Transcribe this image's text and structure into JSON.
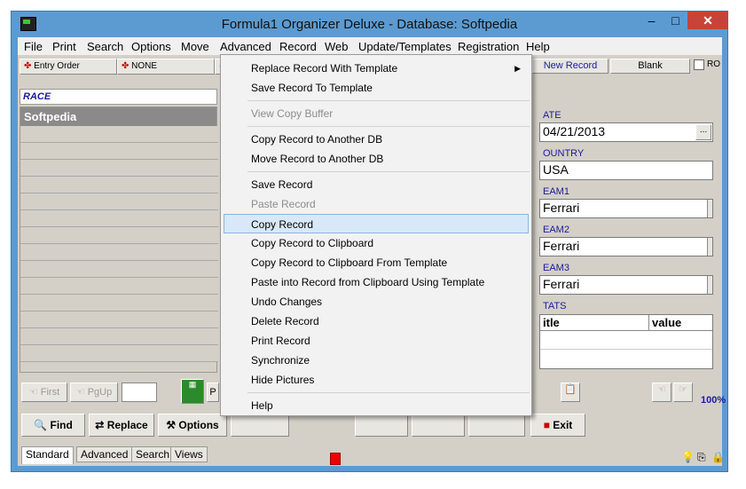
{
  "window": {
    "title": "Formula1 Organizer Deluxe - Database: Softpedia"
  },
  "menubar": [
    "File",
    "Print",
    "Search",
    "Options",
    "Move",
    "Advanced",
    "Record",
    "Web",
    "Update/Templates",
    "Registration",
    "Help"
  ],
  "toolbar": {
    "entry_order": "Entry Order",
    "none": "NONE",
    "new_record": "New Record",
    "blank": "Blank",
    "ro": "RO"
  },
  "list": {
    "header": "RACE",
    "selected": "Softpedia"
  },
  "fields": {
    "date_label": "ATE",
    "date_value": "04/21/2013",
    "date_button": "...",
    "country_label": "OUNTRY",
    "country_value": "USA",
    "team1_label": "EAM1",
    "team1_value": "Ferrari",
    "team2_label": "EAM2",
    "team2_value": "Ferrari",
    "team3_label": "EAM3",
    "team3_value": "Ferrari",
    "stats_label": "TATS",
    "stats_col1": "itle",
    "stats_col2": "value"
  },
  "nav": {
    "first": "First",
    "pgup": "PgUp",
    "p_partial": "P",
    "zoom": "100%"
  },
  "bottom_buttons": {
    "find": "Find",
    "replace": "Replace",
    "options": "Options",
    "exit": "Exit"
  },
  "tabs": [
    "Standard",
    "Advanced",
    "Search",
    "Views"
  ],
  "dropdown": {
    "items": [
      {
        "label": "Replace Record With Template",
        "disabled": false,
        "submenu": true
      },
      {
        "label": "Save Record To Template",
        "disabled": false
      },
      {
        "label": "View Copy Buffer",
        "disabled": true
      },
      {
        "label": "Copy Record to Another DB",
        "disabled": false
      },
      {
        "label": "Move Record to Another DB",
        "disabled": false
      },
      {
        "label": "Save Record",
        "disabled": false
      },
      {
        "label": "Paste Record",
        "disabled": true
      },
      {
        "label": "Copy Record",
        "disabled": false,
        "highlighted": true
      },
      {
        "label": "Copy Record to Clipboard",
        "disabled": false
      },
      {
        "label": "Copy Record to Clipboard From Template",
        "disabled": false
      },
      {
        "label": "Paste into Record from Clipboard Using Template",
        "disabled": false
      },
      {
        "label": "Undo Changes",
        "disabled": false
      },
      {
        "label": "Delete Record",
        "disabled": false
      },
      {
        "label": "Print Record",
        "disabled": false
      },
      {
        "label": "Synchronize",
        "disabled": false
      },
      {
        "label": "Hide Pictures",
        "disabled": false
      },
      {
        "label": "Help",
        "disabled": false
      }
    ]
  },
  "colors": {
    "titlebar": "#5c9bd1",
    "close": "#c7433a",
    "highlight": "#d8e8f8",
    "label": "#1a1a9a"
  }
}
